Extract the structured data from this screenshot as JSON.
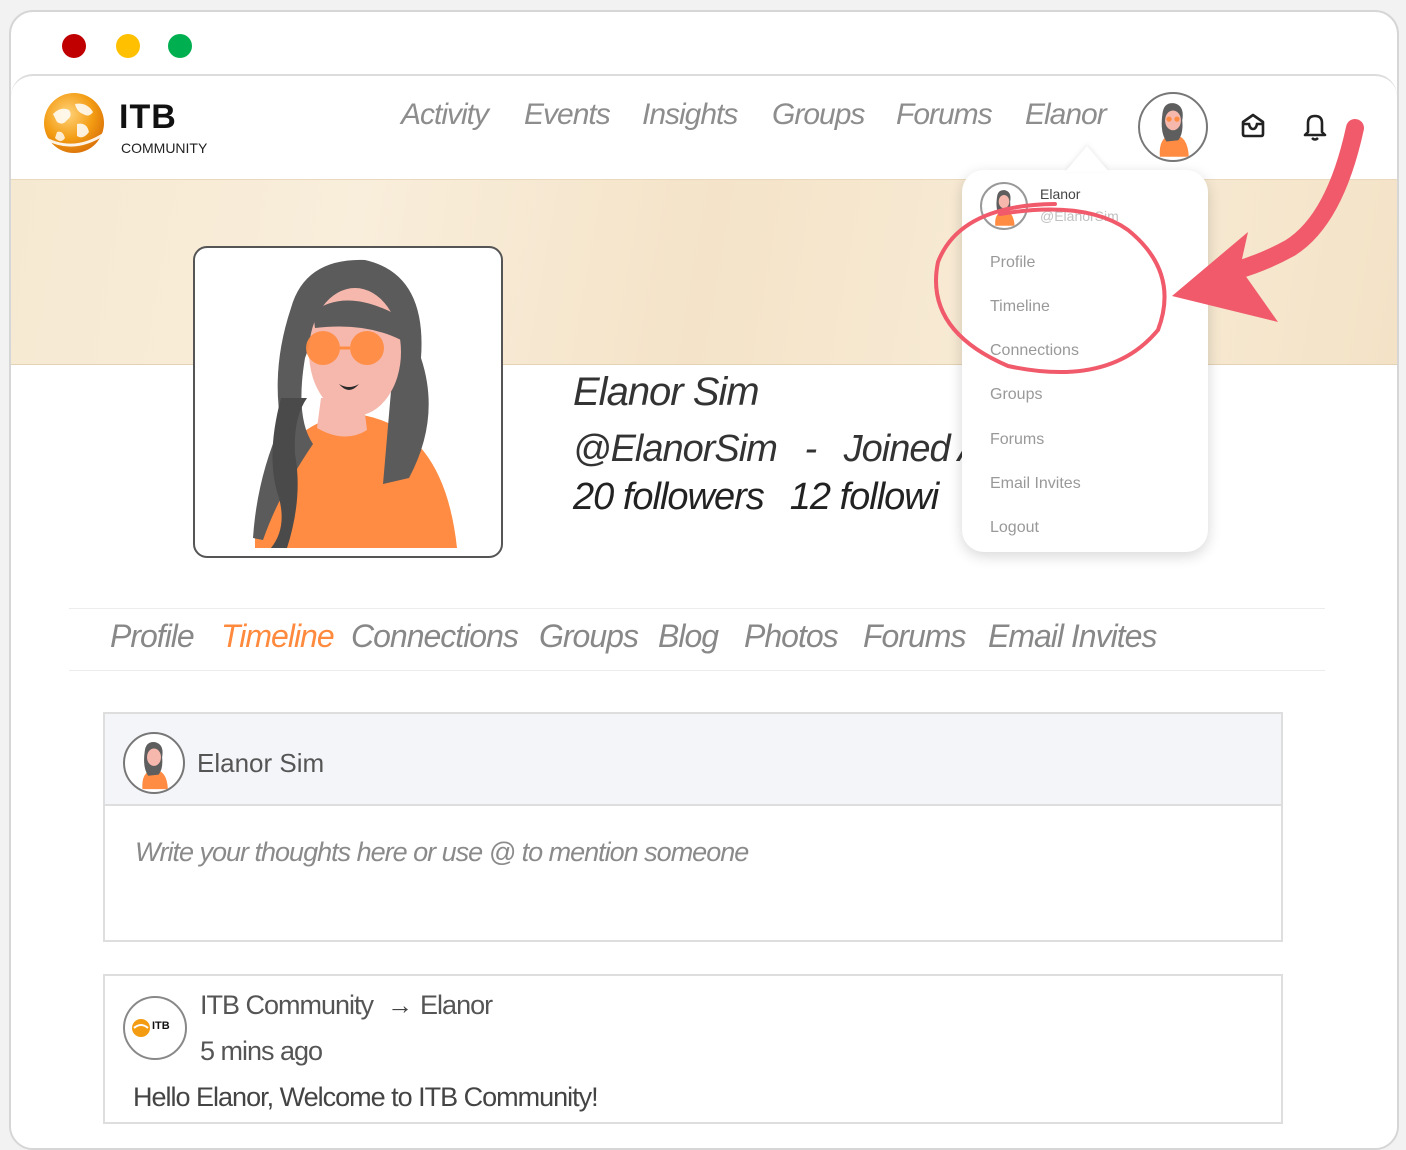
{
  "window": {
    "controls": {
      "close_color": "#c00000",
      "minimize_color": "#ffc000",
      "zoom_color": "#00b050"
    }
  },
  "brand": {
    "name": "ITB",
    "subtitle": "COMMUNITY",
    "globe_color": "#f39c12"
  },
  "nav": {
    "items": [
      "Activity",
      "Events",
      "Insights",
      "Groups",
      "Forums",
      "Elanor"
    ]
  },
  "header_icons": [
    "inbox-icon",
    "bell-icon"
  ],
  "dropdown": {
    "name": "Elanor",
    "handle": "@ElanorSim",
    "items": [
      "Profile",
      "Timeline",
      "Connections",
      "Groups",
      "Forums",
      "Email Invites",
      "Logout"
    ]
  },
  "profile": {
    "name": "Elanor Sim",
    "handle": "@ElanorSim",
    "separator": "-",
    "joined": "Joined Au",
    "followers": "20 followers",
    "following": "12 followi"
  },
  "tabs": {
    "items": [
      "Profile",
      "Timeline",
      "Connections",
      "Groups",
      "Blog",
      "Photos",
      "Forums",
      "Email Invites"
    ],
    "active": "Timeline",
    "active_color": "#ff8a3d"
  },
  "composer": {
    "name": "Elanor Sim",
    "placeholder": "Write your thoughts here or use @ to mention someone"
  },
  "post": {
    "author": "ITB Community",
    "target": "Elanor",
    "arrow": "→",
    "time": "5 mins ago",
    "text": "Hello Elanor, Welcome to ITB Community!",
    "avatar_brand": "ITB"
  },
  "annotation": {
    "color": "#f05a6a"
  }
}
